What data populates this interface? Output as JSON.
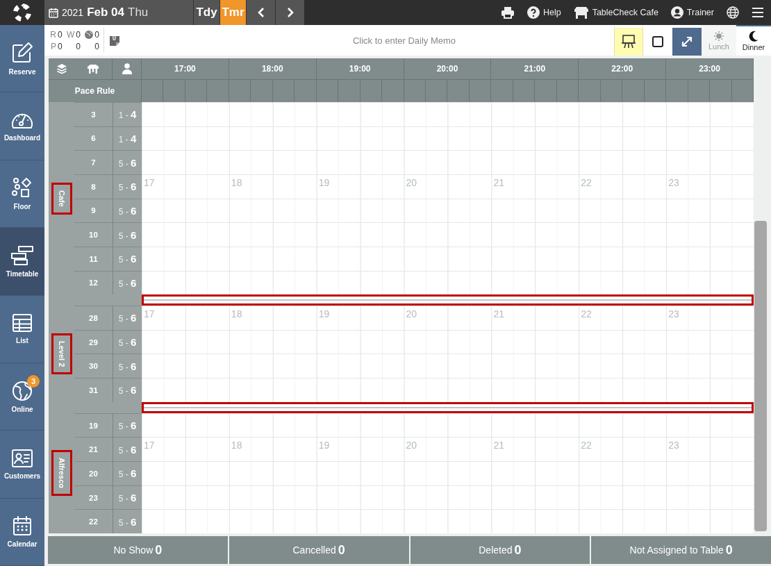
{
  "top_bar": {
    "date": {
      "year": "2021",
      "month_day": "Feb 04",
      "weekday": "Thu"
    },
    "day_buttons": [
      {
        "label": "Tdy",
        "selected": false
      },
      {
        "label": "Tmr",
        "selected": true
      }
    ],
    "nav_buttons": [
      {
        "kind": "prev"
      },
      {
        "kind": "next"
      }
    ],
    "actions": [
      {
        "kind": "print"
      },
      {
        "kind": "help",
        "label": "Help"
      },
      {
        "kind": "store",
        "label": "TableCheck Cafe"
      },
      {
        "kind": "user",
        "label": "Trainer"
      },
      {
        "kind": "globe"
      },
      {
        "kind": "menu"
      }
    ]
  },
  "sidebar": {
    "items": [
      {
        "kind": "reserve",
        "label": "Reserve",
        "selected": false
      },
      {
        "kind": "dashboard",
        "label": "Dashboard",
        "selected": false
      },
      {
        "kind": "floor",
        "label": "Floor",
        "selected": false
      },
      {
        "kind": "timetable",
        "label": "Timetable",
        "selected": true
      },
      {
        "kind": "list",
        "label": "List",
        "selected": false
      },
      {
        "kind": "online",
        "label": "Online",
        "selected": false,
        "badge": "3"
      },
      {
        "kind": "customers",
        "label": "Customers",
        "selected": false
      },
      {
        "kind": "calendar",
        "label": "Calendar",
        "selected": false
      }
    ]
  },
  "toolbar": {
    "counts": [
      [
        {
          "kind": "text",
          "label": "R",
          "value": "0"
        },
        {
          "kind": "text",
          "label": "W",
          "value": "0"
        },
        {
          "kind": "globe",
          "value": "0"
        }
      ],
      [
        {
          "kind": "text",
          "label": "P",
          "value": "0"
        },
        {
          "kind": "blank",
          "value": "0"
        },
        {
          "kind": "blank",
          "value": "0"
        }
      ]
    ],
    "memo": {
      "placeholder": "Click to enter Daily Memo"
    },
    "tools": [
      {
        "kind": "easel",
        "active": true
      },
      {
        "kind": "square",
        "active": false
      },
      {
        "kind": "expand",
        "active": true
      }
    ],
    "meals": [
      {
        "kind": "sun",
        "label": "Lunch",
        "selected": false
      },
      {
        "kind": "moon",
        "label": "Dinner",
        "selected": true
      }
    ]
  },
  "timetable": {
    "header_icons": [
      {
        "kind": "layers"
      },
      {
        "kind": "table"
      },
      {
        "kind": "person"
      }
    ],
    "pace_rule_label": "Pace Rule",
    "hours": [
      "17:00",
      "18:00",
      "19:00",
      "20:00",
      "21:00",
      "22:00",
      "23:00"
    ],
    "areas": [
      {
        "name": "Cafe",
        "highlighted": true,
        "divider_highlighted": true,
        "hour_labels": [
          "17",
          "18",
          "19",
          "20",
          "21",
          "22",
          "23"
        ],
        "rows": [
          {
            "table": "3",
            "pace": "1 - **4**",
            "show_hours": false
          },
          {
            "table": "6",
            "pace": "1 - **4**",
            "show_hours": false
          },
          {
            "table": "7",
            "pace": "5 - **6**",
            "show_hours": false
          },
          {
            "table": "8",
            "pace": "5 - **6**",
            "show_hours": true
          },
          {
            "table": "9",
            "pace": "5 - **6**",
            "show_hours": false
          },
          {
            "table": "10",
            "pace": "5 - **6**",
            "show_hours": false
          },
          {
            "table": "11",
            "pace": "5 - **6**",
            "show_hours": false
          },
          {
            "table": "12",
            "pace": "5 - **6**",
            "show_hours": false
          }
        ]
      },
      {
        "name": "Level 2",
        "highlighted": true,
        "divider_highlighted": true,
        "hour_labels": [
          "17",
          "18",
          "19",
          "20",
          "21",
          "22",
          "23"
        ],
        "rows": [
          {
            "table": "28",
            "pace": "5 - **6**",
            "show_hours": true
          },
          {
            "table": "29",
            "pace": "5 - **6**",
            "show_hours": false
          },
          {
            "table": "30",
            "pace": "5 - **6**",
            "show_hours": false
          },
          {
            "table": "31",
            "pace": "5 - **6**",
            "show_hours": false
          }
        ]
      },
      {
        "name": "Alfresco",
        "highlighted": true,
        "hour_labels": [
          "17",
          "18",
          "19",
          "20",
          "21",
          "22",
          "23"
        ],
        "rows": [
          {
            "table": "19",
            "pace": "5 - **6**",
            "show_hours": false
          },
          {
            "table": "21",
            "pace": "5 - **6**",
            "show_hours": true
          },
          {
            "table": "20",
            "pace": "5 - **6**",
            "show_hours": false
          },
          {
            "table": "23",
            "pace": "5 - **6**",
            "show_hours": false
          },
          {
            "table": "22",
            "pace": "5 - **6**",
            "show_hours": false
          }
        ]
      }
    ]
  },
  "bottom_tabs": [
    {
      "label": "No Show",
      "count": "0"
    },
    {
      "label": "Cancelled",
      "count": "0"
    },
    {
      "label": "Deleted",
      "count": "0"
    },
    {
      "label": "Not Assigned to Table",
      "count": "0"
    }
  ]
}
